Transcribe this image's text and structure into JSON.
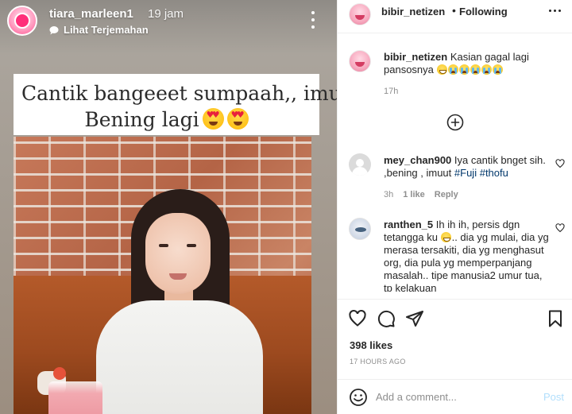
{
  "story": {
    "username": "tiara_marleen1",
    "time_ago": "19 jam",
    "translate_label": "Lihat Terjemahan",
    "caption_line1": "Cantik bangeeet sumpaah,, imut",
    "caption_line2": "Bening lagi",
    "caption_emojis": [
      "heart-eyes",
      "heart-eyes"
    ]
  },
  "post": {
    "header": {
      "username": "bibir_netizen",
      "separator": "•",
      "follow_status": "Following"
    },
    "caption": {
      "username": "bibir_netizen",
      "text": "Kasian gagal lagi pansosnya",
      "emojis": [
        "grinning-sweat",
        "crying",
        "crying",
        "crying",
        "crying",
        "crying"
      ],
      "time": "17h"
    },
    "comments": [
      {
        "username": "mey_chan900",
        "text_plain": "Iya cantik bnget sih. ,bening , imuut",
        "hashtags": [
          "#Fuji",
          "#thofu"
        ],
        "time": "3h",
        "likes": "1 like",
        "reply": "Reply"
      },
      {
        "username": "ranthen_5",
        "text_part1": "Ih ih ih, persis dgn tetangga ku",
        "text_part2": ".. dia yg mulai, dia yg merasa tersakiti, dia yg menghasut org, dia pula yg memperpanjang masalah.. tipe manusia2 umur tua, tp kelakuan"
      }
    ],
    "likes": "398 likes",
    "age": "17 HOURS AGO",
    "add_comment_placeholder": "Add a comment...",
    "post_label": "Post"
  },
  "colors": {
    "link_blue": "#00376b",
    "post_button_disabled": "#b2dffc",
    "meta_gray": "#8e8e8e",
    "text": "#262626"
  }
}
